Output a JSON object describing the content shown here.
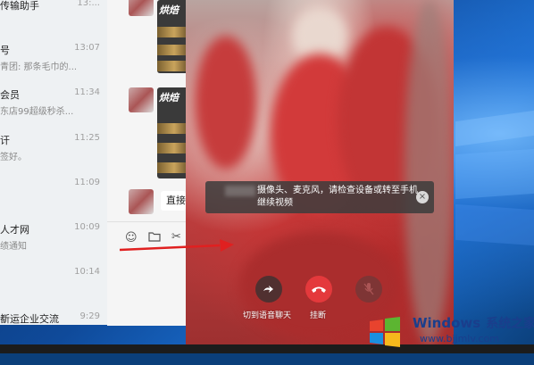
{
  "chat_list": {
    "items": [
      {
        "name": "传输助手",
        "preview": "",
        "time": "13:..."
      },
      {
        "name": "号",
        "preview": "青团: 那条毛巾的...",
        "time": "13:07"
      },
      {
        "name": "会员",
        "preview": "东店99超级秒杀...",
        "time": "11:34"
      },
      {
        "name": "讦",
        "preview": "签好。",
        "time": "11:25"
      },
      {
        "name": "",
        "preview": "",
        "time": "11:09"
      },
      {
        "name": "人才网",
        "preview": "绩通知",
        "time": "10:09"
      },
      {
        "name": "",
        "preview": "",
        "time": "10:14"
      },
      {
        "name": "斱运企业交流",
        "preview": "",
        "time": "9:29"
      }
    ]
  },
  "chat_area": {
    "image_logo": "烘焙",
    "direct_bubble": "直接",
    "tools": [
      "emoji-icon",
      "folder-icon",
      "scissors-icon"
    ]
  },
  "video_call": {
    "toast": {
      "text": "摄像头、麦克风，请检查设备或转至手机继续视频",
      "close_glyph": "×"
    },
    "buttons": {
      "switch_voice_label": "切到语音聊天",
      "hangup_label": "挂断"
    }
  },
  "watermark": {
    "title": "Windows",
    "title_cn": "系统之家",
    "url": "www.bjjmlv.com"
  },
  "colors": {
    "hangup_red": "#e4393c",
    "toast_bg": "#3c3c3c",
    "chat_list_bg": "#eef1f3",
    "watermark_blue": "#1a3e8c"
  }
}
